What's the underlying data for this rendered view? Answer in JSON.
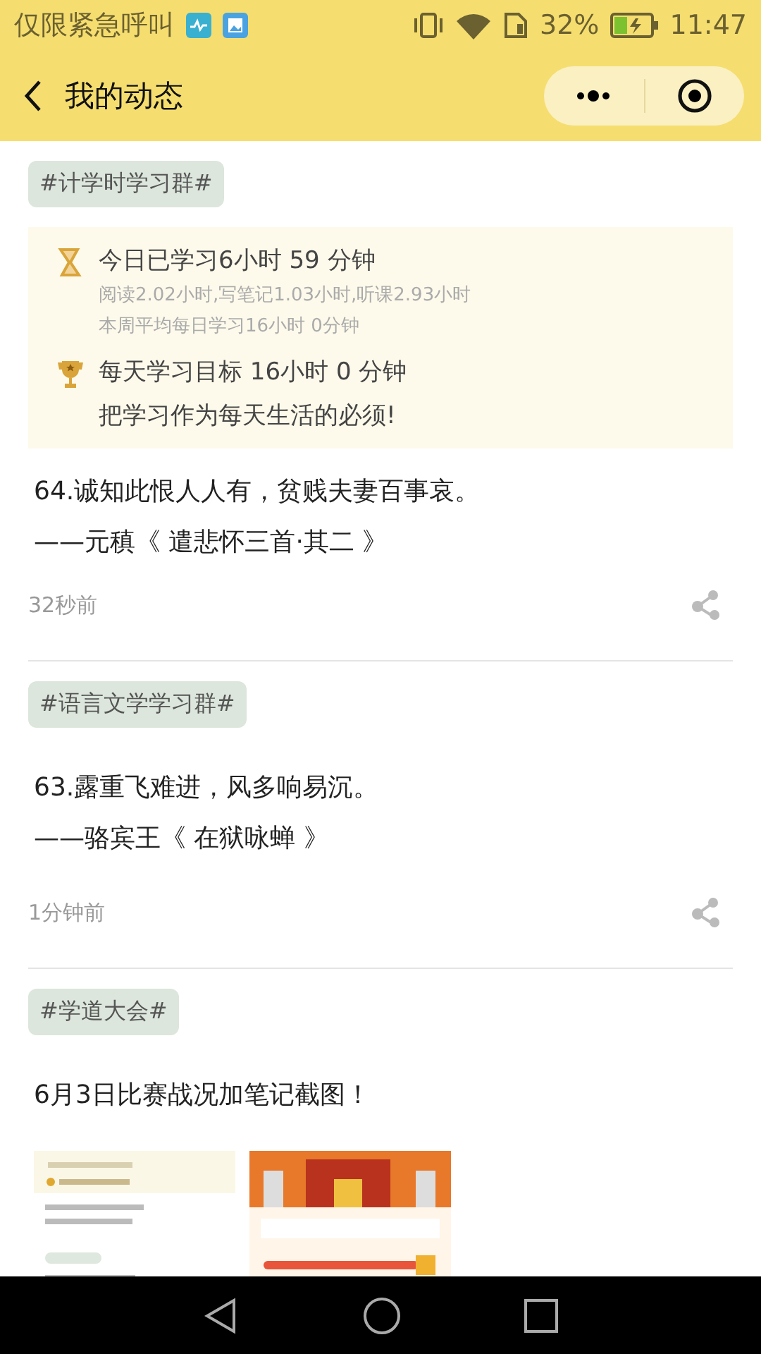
{
  "status_bar": {
    "carrier": "仅限紧急呼叫",
    "battery": "32%",
    "time": "11:47"
  },
  "header": {
    "title": "我的动态"
  },
  "posts": [
    {
      "tag": "#计学时学习群#",
      "stats": {
        "today": "今日已学习6小时 59 分钟",
        "breakdown": "阅读2.02小时,写笔记1.03小时,听课2.93小时",
        "weekly": "本周平均每日学习16小时 0分钟",
        "goal": "每天学习目标 16小时 0 分钟",
        "motto": "把学习作为每天生活的必须!"
      },
      "lines": [
        "64.诚知此恨人人有，贫贱夫妻百事哀。",
        "——元稹《 遣悲怀三首·其二 》"
      ],
      "time": "32秒前"
    },
    {
      "tag": "#语言文学学习群#",
      "lines": [
        "63.露重飞难进，风多响易沉。",
        "——骆宾王《 在狱咏蝉 》"
      ],
      "time": "1分钟前"
    },
    {
      "tag": "#学道大会#",
      "lines": [
        "6月3日比赛战况加笔记截图！"
      ],
      "images": [
        {
          "kind": "picture"
        },
        {
          "kind": "picture"
        }
      ]
    }
  ]
}
